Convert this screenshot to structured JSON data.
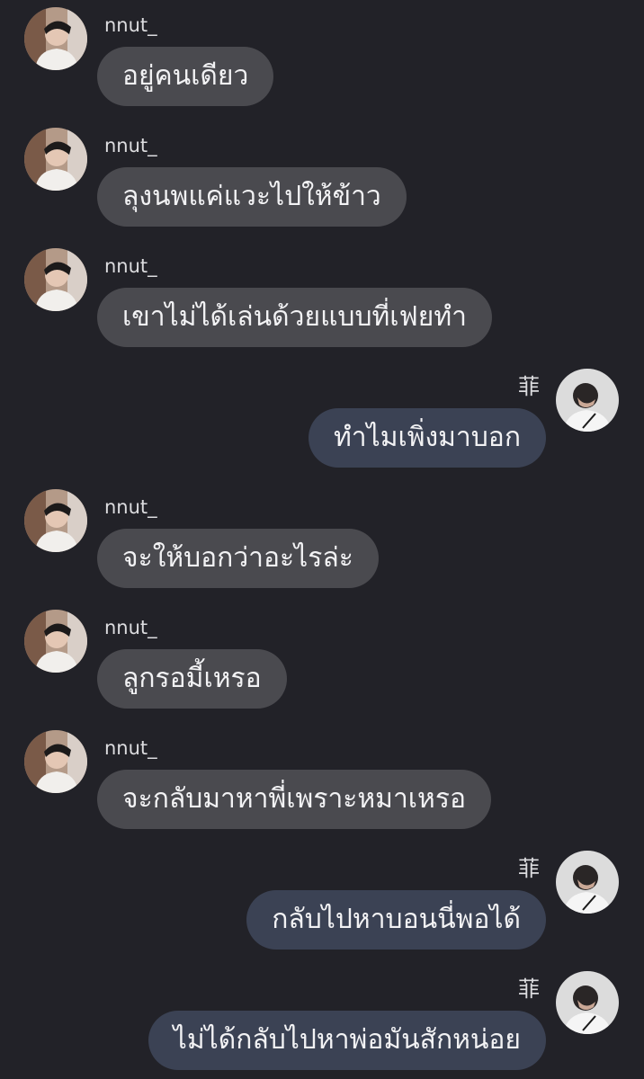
{
  "chat": {
    "messages": [
      {
        "side": "left",
        "sender": "nnut_",
        "text": "อยู่คนเดียว"
      },
      {
        "side": "left",
        "sender": "nnut_",
        "text": "ลุงนพแค่แวะไปให้ข้าว"
      },
      {
        "side": "left",
        "sender": "nnut_",
        "text": "เขาไม่ได้เล่นด้วยแบบที่เฟยทำ"
      },
      {
        "side": "right",
        "sender": "菲",
        "text": "ทำไมเพิ่งมาบอก"
      },
      {
        "side": "left",
        "sender": "nnut_",
        "text": "จะให้บอกว่าอะไรล่ะ"
      },
      {
        "side": "left",
        "sender": "nnut_",
        "text": "ลูกรอมี้เหรอ"
      },
      {
        "side": "left",
        "sender": "nnut_",
        "text": "จะกลับมาหาพี่เพราะหมาเหรอ"
      },
      {
        "side": "right",
        "sender": "菲",
        "text": "กลับไปหาบอนนี่พอได้"
      },
      {
        "side": "right",
        "sender": "菲",
        "text": "ไม่ได้กลับไปหาพ่อมันสักหน่อย"
      }
    ]
  },
  "colors": {
    "background": "#222228",
    "incoming_bubble": "#4a4a4f",
    "outgoing_bubble": "#3b4254",
    "text": "#f2f2f4"
  }
}
